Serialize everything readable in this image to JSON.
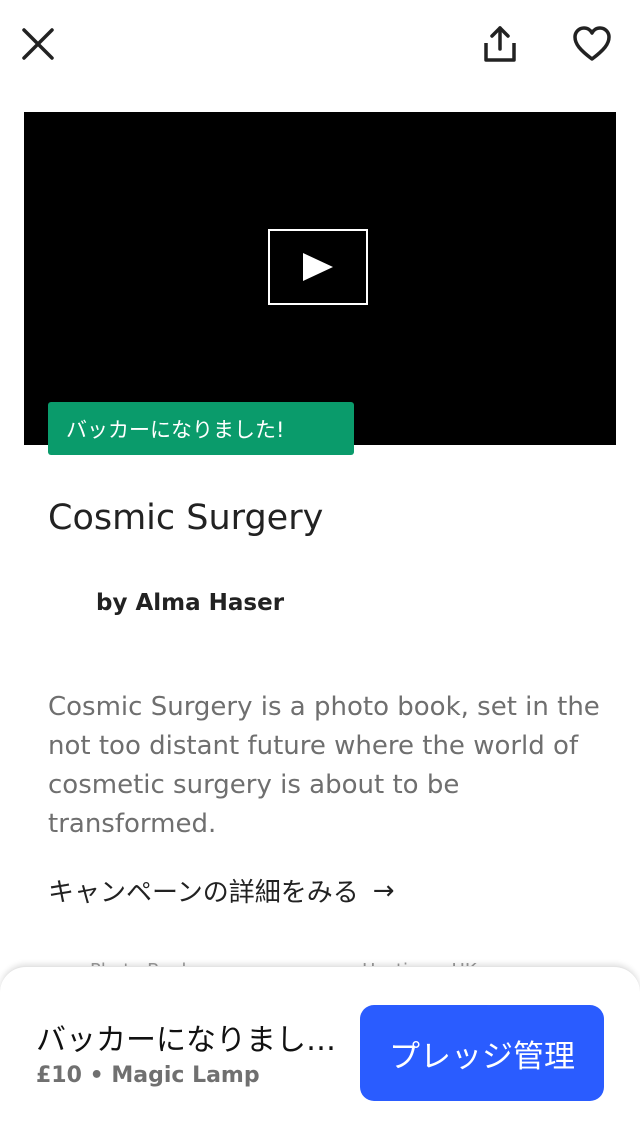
{
  "header": {
    "close_icon": "close-icon",
    "share_icon": "share-icon",
    "favorite_icon": "heart-icon"
  },
  "video": {
    "play_icon": "play-icon",
    "badge": "バッカーになりました!"
  },
  "project": {
    "title": "Cosmic Surgery",
    "author": "by Alma Haser",
    "description": "Cosmic Surgery is a photo book, set in the not too distant future where the world of cosmetic surgery is about to be transformed.",
    "details_link": "キャンペーンの詳細をみる",
    "category": "Photo Books",
    "location": "Hastings, UK"
  },
  "footer": {
    "status": "バッカーになりました!",
    "pledge_amount": "£10",
    "reward": "Magic Lamp",
    "manage_button": "プレッジ管理"
  },
  "colors": {
    "badge_green": "#0a9b6b",
    "primary_blue": "#2a5cff"
  }
}
